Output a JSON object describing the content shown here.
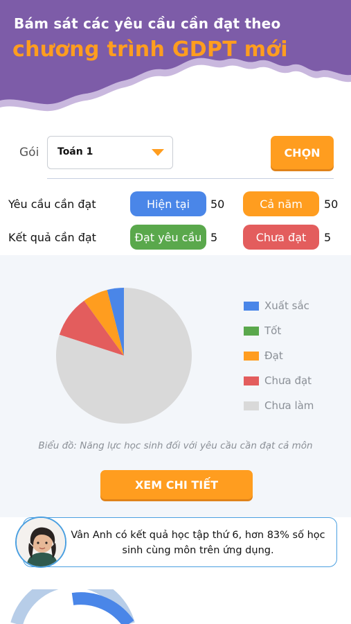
{
  "banner": {
    "line1": "Bám sát các yêu cầu cần đạt theo",
    "line2": "chương trình GDPT mới"
  },
  "package": {
    "label": "Gói",
    "selected": "Toán 1",
    "choose_button": "CHỌN",
    "caret_icon": "triangle-down"
  },
  "requirements": {
    "label": "Yêu cầu cần đạt",
    "current_label": "Hiện tại",
    "current_value": "50",
    "year_label": "Cả năm",
    "year_value": "50"
  },
  "results": {
    "label": "Kết quả cần đạt",
    "passed_label": "Đạt yêu cầu",
    "passed_value": "5",
    "failed_label": "Chưa đạt",
    "failed_value": "5"
  },
  "colors": {
    "banner": "#7d5ca8",
    "accent_orange": "#ff9d1f",
    "blue": "#4a86e8",
    "green": "#5aa84c",
    "red": "#e35d5d",
    "gray": "#d9d9d9"
  },
  "chart_data": {
    "type": "pie",
    "title": "",
    "caption": "Biểu đồ: Năng lực học sinh đối với yêu cầu cần đạt cả môn",
    "legend_position": "right",
    "series": [
      {
        "name": "Xuất sắc",
        "value": 4,
        "color": "#4a86e8"
      },
      {
        "name": "Tốt",
        "value": 0,
        "color": "#5aa84c"
      },
      {
        "name": "Đạt",
        "value": 6,
        "color": "#ff9d1f"
      },
      {
        "name": "Chưa đạt",
        "value": 10,
        "color": "#e35d5d"
      },
      {
        "name": "Chưa làm",
        "value": 80,
        "color": "#d9d9d9"
      }
    ]
  },
  "detail_button": "XEM CHI TIẾT",
  "info": {
    "text": "Vân Anh có kết quả học tập thứ 6, hơn 83% số học sinh cùng môn trên ứng dụng."
  }
}
